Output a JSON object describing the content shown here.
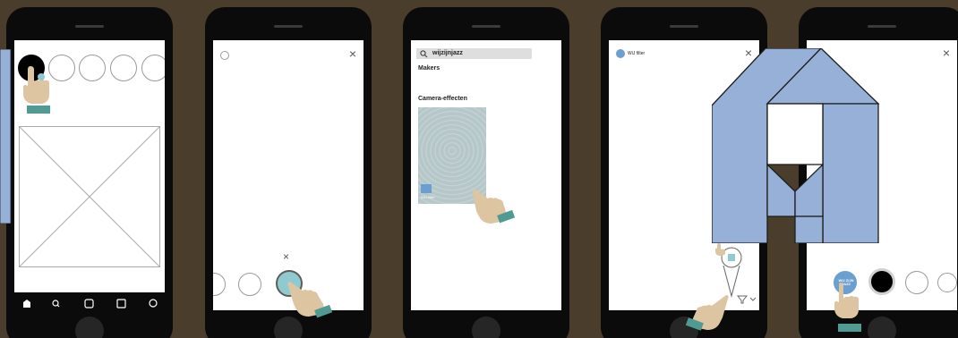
{
  "colors": {
    "background": "#4a3d2c",
    "phone_body": "#0b0b0b",
    "screen": "#ffffff",
    "accent_blue": "#96b0d8",
    "hand_skin": "#dcc5a0",
    "hand_cuff": "#4f9a93",
    "teal_button": "#8fcad0",
    "search_bar": "#dedede"
  },
  "screen3": {
    "search_text": "wijzijnjazz",
    "makers_heading": "Makers",
    "effects_heading": "Camera-effecten",
    "card_caption": "WiJ filter"
  },
  "screen4": {
    "filter_name": "WiJ filter"
  },
  "screen5": {
    "badge_text": "WIJ ZIJN JAZZ"
  },
  "icons": [
    "close-icon",
    "search-icon",
    "home-icon",
    "hand-pointer-icon",
    "logo-a-icon",
    "filter-icon",
    "chevron-down-icon"
  ]
}
